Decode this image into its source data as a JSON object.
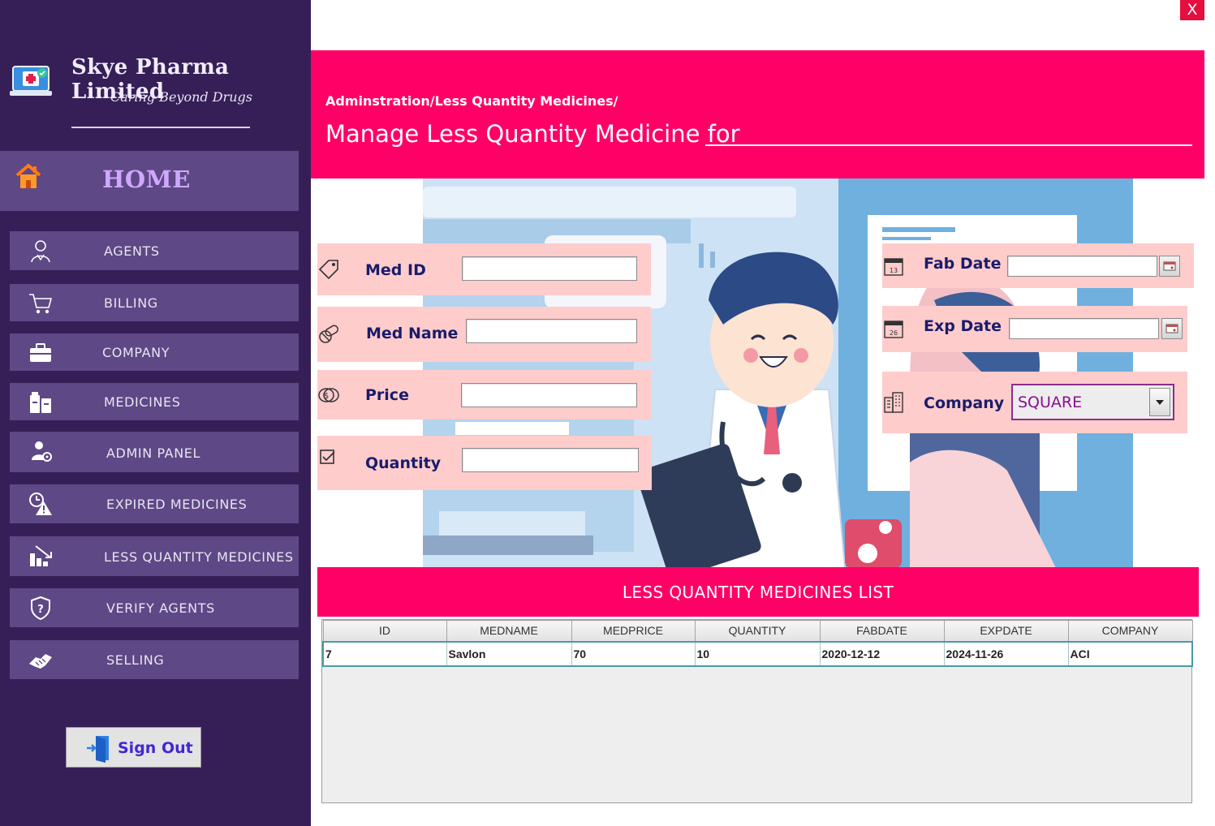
{
  "app": {
    "brand_name": "Skye Pharma Limited",
    "brand_tagline": "Caring Beyond Drugs",
    "close_label": "X"
  },
  "sidebar": {
    "home_label": "HOME",
    "items": [
      {
        "label": "AGENTS",
        "icon": "agent-icon"
      },
      {
        "label": "BILLING",
        "icon": "cart-icon"
      },
      {
        "label": "COMPANY",
        "icon": "briefcase-icon"
      },
      {
        "label": "MEDICINES",
        "icon": "medicine-bottles-icon"
      },
      {
        "label": "ADMIN PANEL",
        "icon": "admin-gear-icon"
      },
      {
        "label": "EXPIRED MEDICINES",
        "icon": "warning-clock-icon"
      },
      {
        "label": "LESS QUANTITY MEDICINES",
        "icon": "bar-down-icon"
      },
      {
        "label": "VERIFY AGENTS",
        "icon": "shield-question-icon"
      },
      {
        "label": "SELLING",
        "icon": "handshake-icon"
      }
    ],
    "signout_label": "Sign Out"
  },
  "header": {
    "breadcrumb": "Adminstration/Less Quantity Medicines/",
    "title": "Manage Less Quantity Medicine for"
  },
  "form": {
    "med_id_label": "Med ID",
    "med_id_value": "",
    "med_name_label": "Med Name",
    "med_name_value": "",
    "price_label": "Price",
    "price_value": "",
    "quantity_label": "Quantity",
    "quantity_value": "",
    "fab_date_label": "Fab Date",
    "fab_date_value": "",
    "exp_date_label": "Exp Date",
    "exp_date_value": "",
    "company_label": "Company",
    "company_selected": "SQUARE"
  },
  "list": {
    "title": "LESS QUANTITY MEDICINES LIST",
    "columns": [
      "ID",
      "MEDNAME",
      "MEDPRICE",
      "QUANTITY",
      "FABDATE",
      "EXPDATE",
      "COMPANY"
    ],
    "rows": [
      [
        "7",
        "Savlon",
        "70",
        "10",
        "2020-12-12",
        "2024-11-26",
        "ACI"
      ]
    ]
  },
  "colors": {
    "sidebar_bg": "#361f57",
    "nav_item_bg": "#5e4885",
    "accent_pink": "#ff0066",
    "field_panel_bg": "#ffcccc",
    "label_navy": "#1a1c6b"
  }
}
